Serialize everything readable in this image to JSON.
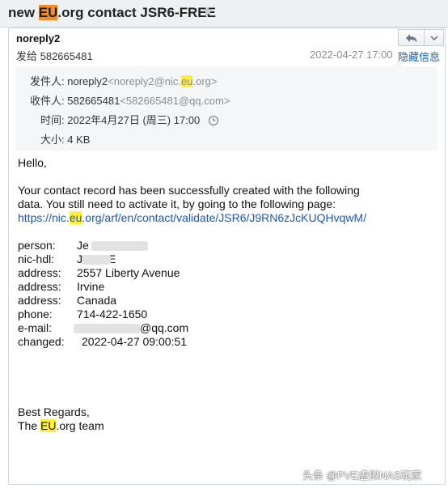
{
  "subject": {
    "prefix": "new ",
    "highlight": "EU",
    "suffix": ".org contact JSR6-FREE"
  },
  "sender": "noreply2",
  "to_line": "发给 582665481",
  "date": "2022-04-27 17:00",
  "hide_details": "隐藏信息",
  "details": {
    "from_label": "发件人:",
    "from_name": "noreply2",
    "from_addr_pre": "<noreply2@nic.",
    "from_addr_hl": "eu",
    "from_addr_post": ".org>",
    "to_label": "收件人:",
    "to_name": "582665481",
    "to_addr": "<582665481@qq.com>",
    "time_label": "时间:",
    "time_value": "2022年4月27日 (周三) 17:00",
    "size_label": "大小:",
    "size_value": "4 KB"
  },
  "body": {
    "greeting": "Hello,",
    "line1": "Your contact record has been successfully created with the following",
    "line2": "data. You still need to activate it, by going to the following page:",
    "link_pre": "https://nic.",
    "link_hl": "eu",
    "link_post": ".org/arf/en/contact/validate/JSR6/J9RN6zJcKUQHvqwM/",
    "fields": [
      {
        "label": "person:",
        "value": "Je        son"
      },
      {
        "label": "nic-hdl:",
        "value": "J      FREE"
      },
      {
        "label": "address:",
        "value": "2557 Liberty Avenue"
      },
      {
        "label": "address:",
        "value": "Irvine"
      },
      {
        "label": "address:",
        "value": "Canada"
      },
      {
        "label": "phone:",
        "value": "714-422-1650"
      },
      {
        "label": "e-mail:",
        "value": "@qq.com"
      },
      {
        "label": "changed:",
        "value": "2022-04-27 09:00:51"
      }
    ],
    "regards": "Best Regards,",
    "team_pre": "The ",
    "team_hl": "EU",
    "team_post": ".org team"
  },
  "watermark": "头条 @PVE虚拟NAS玩家",
  "colors": {
    "highlight_orange": "#f28c28",
    "highlight_yellow": "#ffef3a",
    "link": "#1a57c8",
    "date_grey": "#8c8c8c"
  },
  "icons": [
    "star-icon",
    "reply-icon",
    "chevron-down-icon",
    "clock-icon"
  ]
}
